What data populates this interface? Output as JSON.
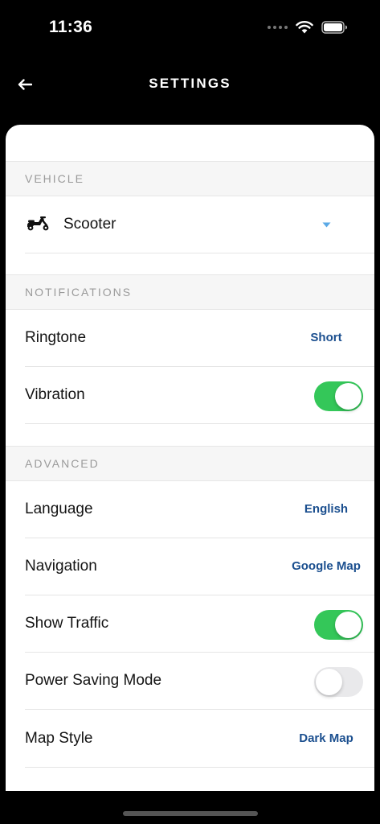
{
  "status_bar": {
    "time": "11:36"
  },
  "header": {
    "title": "SETTINGS"
  },
  "sections": {
    "vehicle": {
      "title": "VEHICLE"
    },
    "notifications": {
      "title": "NOTIFICATIONS"
    },
    "advanced": {
      "title": "ADVANCED"
    }
  },
  "vehicle": {
    "selected": "Scooter",
    "icon": "scooter-icon"
  },
  "notifications": {
    "ringtone": {
      "label": "Ringtone",
      "value": "Short"
    },
    "vibration": {
      "label": "Vibration",
      "on": true
    }
  },
  "advanced": {
    "language": {
      "label": "Language",
      "value": "English"
    },
    "navigation": {
      "label": "Navigation",
      "value": "Google Map"
    },
    "show_traffic": {
      "label": "Show Traffic",
      "on": true
    },
    "power_saving": {
      "label": "Power Saving Mode",
      "on": false
    },
    "map_style": {
      "label": "Map Style",
      "value": "Dark Map"
    }
  },
  "colors": {
    "accent_value": "#1b4f8f",
    "toggle_on": "#34c759",
    "toggle_off": "#e9e9eb",
    "dropdown_caret": "#5aa9e6"
  }
}
